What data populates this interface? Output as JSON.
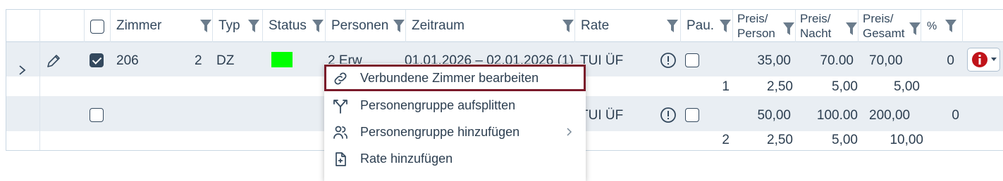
{
  "header": {
    "zimmer": "Zimmer",
    "typ": "Typ",
    "status": "Status",
    "personen": "Personen",
    "zeitraum": "Zeitraum",
    "rate": "Rate",
    "pau": "Pau.",
    "preis_person_1": "Preis/",
    "preis_person_2": "Person",
    "preis_nacht_1": "Preis/",
    "preis_nacht_2": "Nacht",
    "preis_gesamt_1": "Preis/",
    "preis_gesamt_2": "Gesamt",
    "pct": "%"
  },
  "rows": [
    {
      "zimmer": "206",
      "count": "2",
      "typ": "DZ",
      "status_color": "#00ff00",
      "personen": "2 Erw",
      "zeitraum": "01.01.2026 – 02.01.2026 (1)",
      "rate": "TUI ÜF",
      "preis_person": "35,00",
      "preis_nacht": "70.00",
      "preis_gesamt": "70,00",
      "pct": "0",
      "selected": true,
      "sub": {
        "qty": "1",
        "preis_person": "2,50",
        "preis_nacht": "5,00",
        "preis_gesamt": "5,00"
      }
    },
    {
      "rate": "TUI ÜF",
      "preis_person": "50,00",
      "preis_nacht": "100.00",
      "preis_gesamt": "200,00",
      "pct": "0",
      "selected": false,
      "sub": {
        "qty": "2",
        "preis_person": "2,50",
        "preis_nacht": "5,00",
        "preis_gesamt": "10,00"
      }
    }
  ],
  "context_menu": {
    "items": [
      {
        "label": "Verbundene Zimmer bearbeiten",
        "icon": "link-icon"
      },
      {
        "label": "Personengruppe aufsplitten",
        "icon": "split-icon"
      },
      {
        "label": "Personengruppe hinzufügen",
        "icon": "add-people-icon"
      },
      {
        "label": "Rate hinzufügen",
        "icon": "add-file-icon"
      }
    ]
  },
  "colors": {
    "selected_outline": "#7a1a2a",
    "info_red": "#c0131a",
    "row_bg": "#e9eef3"
  }
}
